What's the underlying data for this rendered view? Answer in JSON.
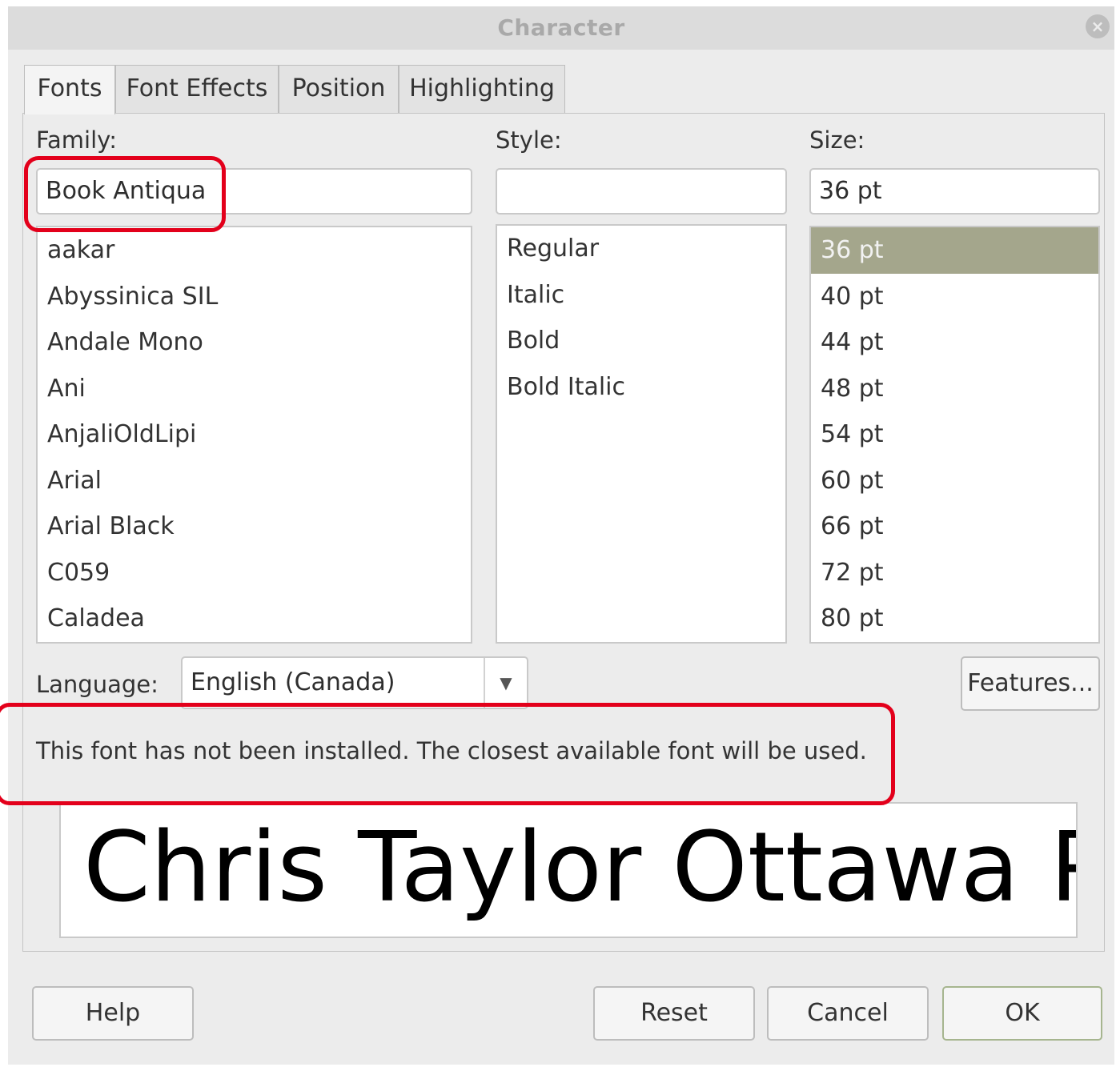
{
  "window": {
    "title": "Character",
    "close_icon": "×"
  },
  "tabs": [
    {
      "label": "Fonts",
      "active": true
    },
    {
      "label": "Font Effects",
      "active": false
    },
    {
      "label": "Position",
      "active": false
    },
    {
      "label": "Highlighting",
      "active": false
    }
  ],
  "family": {
    "label": "Family:",
    "value": "Book Antiqua",
    "items": [
      "aakar",
      "Abyssinica SIL",
      "Andale Mono",
      "Ani",
      "AnjaliOldLipi",
      "Arial",
      "Arial Black",
      "C059",
      "Caladea"
    ]
  },
  "style": {
    "label": "Style:",
    "value": "",
    "items": [
      "Regular",
      "Italic",
      "Bold",
      "Bold Italic"
    ]
  },
  "size": {
    "label": "Size:",
    "value": "36 pt",
    "items": [
      "36 pt",
      "40 pt",
      "44 pt",
      "48 pt",
      "54 pt",
      "60 pt",
      "66 pt",
      "72 pt",
      "80 pt"
    ],
    "selected_index": 0
  },
  "language": {
    "label": "Language:",
    "value": "English (Canada)",
    "arrow_icon": "▼"
  },
  "features_button": "Features...",
  "notice": "This font has not been installed. The closest available font will be used.",
  "preview": {
    "text": "Chris Taylor Ottawa PO"
  },
  "buttons": {
    "help": "Help",
    "reset": "Reset",
    "cancel": "Cancel",
    "ok": "OK"
  },
  "colors": {
    "highlight_annotation": "#e3001b",
    "selected_item": "#a4a68c"
  }
}
